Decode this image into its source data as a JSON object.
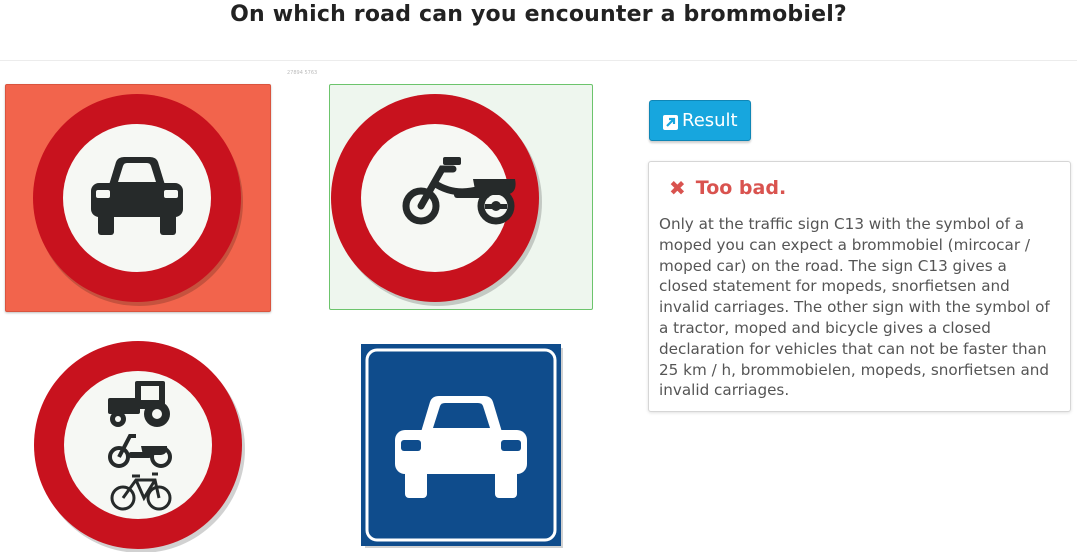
{
  "question": "On which road can you encounter a brommobiel?",
  "watermark": "27894 5763",
  "options": [
    {
      "name": "car-prohibition-sign",
      "state": "selected-wrong",
      "icon": "car-icon"
    },
    {
      "name": "moped-prohibition-sign",
      "state": "correct",
      "icon": "moped-icon"
    },
    {
      "name": "tractor-moped-bicycle-prohibition-sign",
      "state": "unselected",
      "icon": "tractor-moped-bicycle-icon"
    },
    {
      "name": "motorway-car-road-sign",
      "state": "unselected",
      "icon": "car-icon"
    }
  ],
  "result_button": {
    "label": "Result",
    "icon": "external-link-icon"
  },
  "feedback": {
    "status_icon": "x-icon",
    "title": "Too bad.",
    "body": "Only at the traffic sign C13 with the symbol of a moped you can expect a brommobiel (mircocar / moped car) on the road. The sign C13 gives a closed statement for mopeds, snorfietsen and invalid carriages. The other sign with the symbol of a tractor, moped and bicycle gives a closed declaration for vehicles that can not be faster than 25 km / h, brommobielen, mopeds, snorfietsen and invalid carriages."
  },
  "colors": {
    "wrong_bg": "#f2644c",
    "correct_bg": "#eef6ee",
    "correct_border": "#6cc46c",
    "sign_red": "#c8121e",
    "road_blue": "#0f4c8c",
    "button_blue": "#17a6de",
    "error_red": "#d9534f"
  }
}
